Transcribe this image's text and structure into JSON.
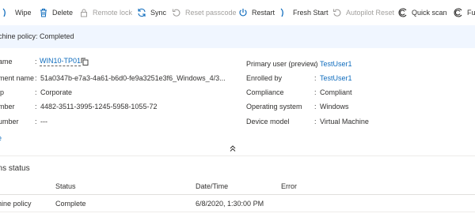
{
  "toolbar": {
    "wipe": "Wipe",
    "delete": "Delete",
    "remote_lock": "Remote lock",
    "sync": "Sync",
    "reset_passcode": "Reset passcode",
    "restart": "Restart",
    "fresh_start": "Fresh Start",
    "autopilot_reset": "Autopilot Reset",
    "quick_scan": "Quick scan",
    "full_scan": "Fu"
  },
  "banner": {
    "text": "achine policy: Completed"
  },
  "properties_left": [
    {
      "label": "ame",
      "value": "WIN10-TP01"
    },
    {
      "label": "ment name",
      "value": "51a0347b-e7a3-4a61-b6d0-fe9a3251e3f6_Windows_4/3..."
    },
    {
      "label": "ip",
      "value": "Corporate"
    },
    {
      "label": "mber",
      "value": "4482-3511-3995-1245-5958-1055-72"
    },
    {
      "label": "umber",
      "value": "---"
    }
  ],
  "properties_right": [
    {
      "label": "Primary user (preview)",
      "value": "TestUser1"
    },
    {
      "label": "Enrolled by",
      "value": "TestUser1"
    },
    {
      "label": "Compliance",
      "value": "Compliant"
    },
    {
      "label": "Operating system",
      "value": "Windows"
    },
    {
      "label": "Device model",
      "value": "Virtual Machine"
    }
  ],
  "colon": ":",
  "see_more": "e",
  "status_section": {
    "title": "ons status",
    "columns": [
      "Status",
      "Date/Time",
      "Error"
    ],
    "row": {
      "name": "hine policy",
      "status": "Complete",
      "datetime": "6/8/2020, 1:30:00 PM",
      "error": ""
    }
  },
  "colors": {
    "link": "#0f6cbd",
    "banner_bg": "#f0f6ff",
    "disabled": "#a19f9d"
  }
}
